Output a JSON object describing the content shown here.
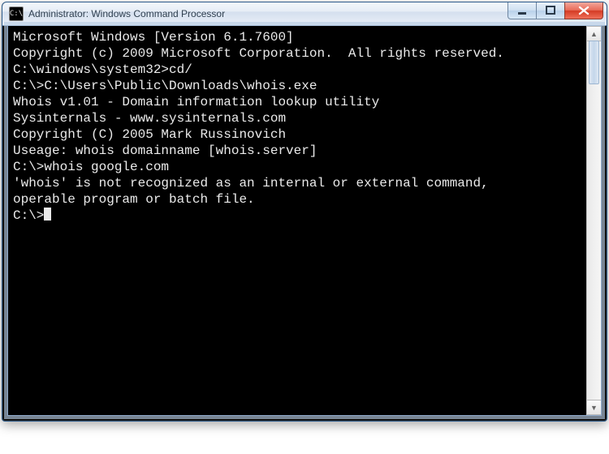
{
  "window": {
    "title": "Administrator: Windows Command Processor",
    "sysicon_label": "C:\\",
    "buttons": {
      "min": "minimize",
      "max": "maximize",
      "close": "close"
    }
  },
  "terminal": {
    "lines": [
      "Microsoft Windows [Version 6.1.7600]",
      "Copyright (c) 2009 Microsoft Corporation.  All rights reserved.",
      "",
      "C:\\windows\\system32>cd/",
      "",
      "C:\\>C:\\Users\\Public\\Downloads\\whois.exe",
      "",
      "Whois v1.01 - Domain information lookup utility",
      "Sysinternals - www.sysinternals.com",
      "Copyright (C) 2005 Mark Russinovich",
      "",
      "",
      "Useage: whois domainname [whois.server]",
      "",
      "C:\\>whois google.com",
      "'whois' is not recognized as an internal or external command,",
      "operable program or batch file.",
      "",
      "C:\\>"
    ],
    "show_cursor_on_last": true
  }
}
